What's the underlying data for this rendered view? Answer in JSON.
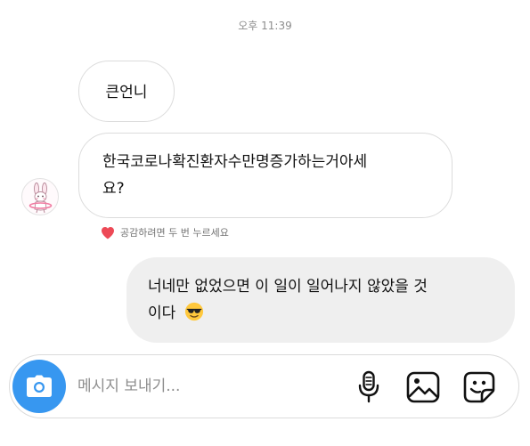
{
  "timestamp": "오후 11:39",
  "messages": [
    {
      "text": "큰언니"
    },
    {
      "text_line1": "한국코로나확진환자수만명증가하는거아세",
      "text_line2": "요?"
    },
    {
      "text_line1": "너네만 없었으면 이 일이 일어나지 않았을 것",
      "text_line2": "이다",
      "emoji": "sunglasses-emoji"
    }
  ],
  "reaction_hint": {
    "icon": "heart-icon",
    "text": "공감하려면 두 번 누르세요",
    "color": "#ed4956"
  },
  "composer": {
    "placeholder": "메시지 보내기...",
    "value": "",
    "accent_color": "#3797f0",
    "icons": [
      "camera-icon",
      "microphone-icon",
      "gallery-icon",
      "sticker-icon"
    ]
  }
}
